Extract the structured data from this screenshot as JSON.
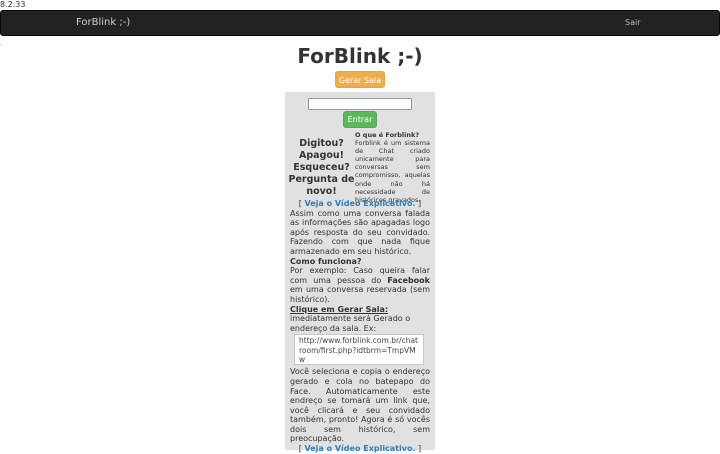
{
  "version": "8.2.33",
  "navbar": {
    "brand": "ForBlink ;-)",
    "logout": "Sair"
  },
  "page": {
    "title": "ForBlink ;-)",
    "generate_button": "Gerar Sala"
  },
  "form": {
    "room_value": "",
    "enter_button": "Entrar"
  },
  "slogan": "Digitou? Apagou! Esqueceu? Pergunta de novo!",
  "about": {
    "title": "O que é Forblink?",
    "text": "Forblink é um sistema de Chat criado unicamente para conversas sem compromisso, aquelas onde não há necessidade de históricos gravados."
  },
  "video_link": "Veja o Vídeo Explicativo.",
  "info": {
    "p1": "Assim como uma conversa falada as informações são apagadas logo após resposta do seu convidado. Fazendo com que nada fique armazenado em seu histórico.",
    "how_title": "Como funciona?",
    "p2_before": "Por exemplo: Caso queira falar com uma pessoa do ",
    "p2_bold": "Facebook",
    "p2_after": " em uma conversa reservada (sem histórico).",
    "click_title": "Clique em Gerar Sala:",
    "p3": "imediatamente será Gerado o endereço da sala. Ex:",
    "example_url": "http://www.forblink.com.br/chatroom/first.php?idtbrm=TmpVMw",
    "p4": "Você seleciona e copia o endereço gerado e cola no batepapo do Face. Automaticamente este endreço se tomará um link que, você clicará e seu convidado também, pronto! Agora é só vocês dois sem histórico, sem preocupação."
  }
}
